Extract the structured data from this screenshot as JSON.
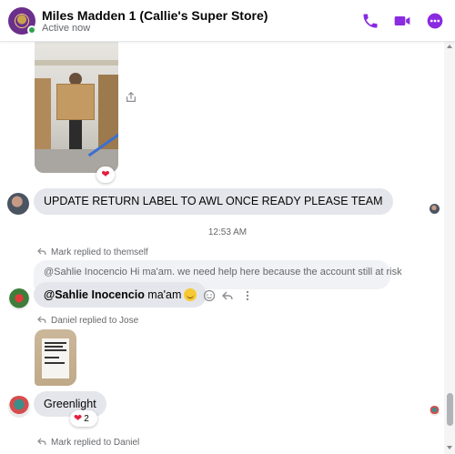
{
  "header": {
    "title": "Miles Madden 1 (Callie's Super Store)",
    "status": "Active now",
    "icons": [
      "phone-icon",
      "video-icon",
      "more-icon"
    ],
    "accent_color": "#8a2be2"
  },
  "messages": {
    "bubble1": "UPDATE RETURN LABEL TO AWL ONCE READY PLEASE TEAM",
    "timestamp": "12:53 AM",
    "reply_meta_1": "Mark replied to themself",
    "quoted_text": "@Sahlie Inocencio Hi ma'am. we need help here because the account still at risk",
    "bubble2_mention": "@Sahlie Inocencio",
    "bubble2_text": " ma'am",
    "reply_meta_2": "Daniel replied to Jose",
    "bubble3": "Greenlight",
    "reaction_count": "2",
    "reply_meta_3": "Mark replied to Daniel"
  },
  "colors": {
    "bubble_bg": "#e4e6eb",
    "heart": "#e41e3f",
    "online": "#31a24c"
  }
}
